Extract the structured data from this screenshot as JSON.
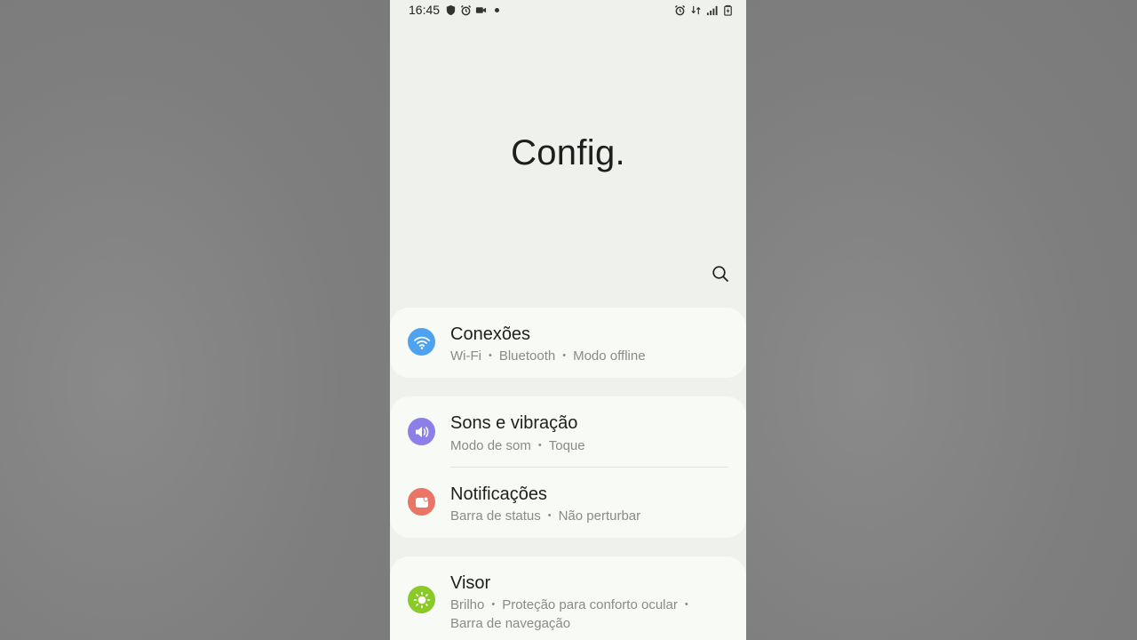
{
  "status_bar": {
    "time": "16:45"
  },
  "page": {
    "title": "Config."
  },
  "colors": {
    "connections_icon": "#4da3ef",
    "sounds_icon": "#8d7fe8",
    "notifications_icon": "#ea7466",
    "display_icon": "#8ac926"
  },
  "settings": [
    {
      "title": "Conexões",
      "icon": "wifi-icon",
      "subtitle_parts": [
        "Wi-Fi",
        "Bluetooth",
        "Modo offline"
      ]
    },
    {
      "title": "Sons e vibração",
      "icon": "speaker-icon",
      "subtitle_parts": [
        "Modo de som",
        "Toque"
      ]
    },
    {
      "title": "Notificações",
      "icon": "notification-icon",
      "subtitle_parts": [
        "Barra de status",
        "Não perturbar"
      ]
    },
    {
      "title": "Visor",
      "icon": "sun-icon",
      "subtitle_parts": [
        "Brilho",
        "Proteção para conforto ocular",
        "Barra de navegação"
      ]
    }
  ]
}
